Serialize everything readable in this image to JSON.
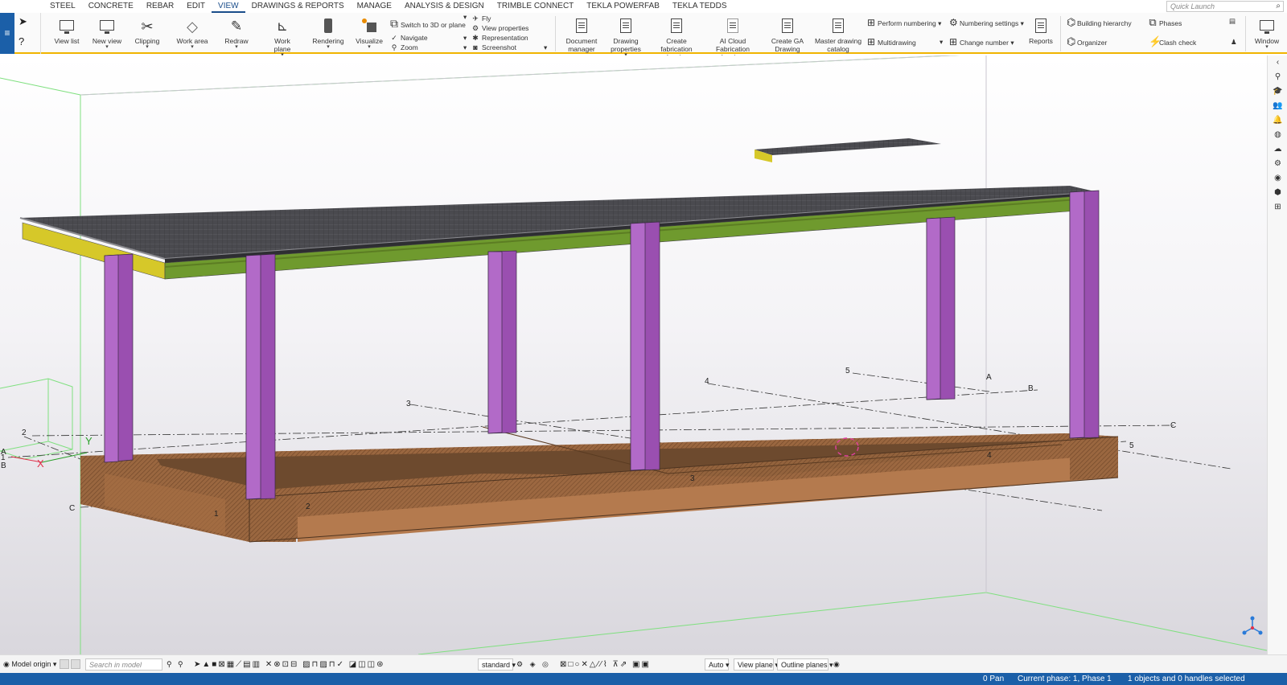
{
  "menu": [
    "STEEL",
    "CONCRETE",
    "REBAR",
    "EDIT",
    "VIEW",
    "DRAWINGS & REPORTS",
    "MANAGE",
    "ANALYSIS & DESIGN",
    "TRIMBLE CONNECT",
    "TEKLA POWERFAB",
    "TEKLA TEDDS"
  ],
  "quick_launch": {
    "placeholder": "Quick Launch"
  },
  "ribbon": {
    "view_list": "View list",
    "new_view": "New view",
    "clipping": "Clipping",
    "work_area": "Work area",
    "redraw": "Redraw",
    "work_plane": "Work plane",
    "rendering": "Rendering",
    "visualize": "Visualize",
    "switch_3d": "Switch to 3D or plane",
    "navigate": "Navigate",
    "zoom": "Zoom",
    "fly": "Fly",
    "view_properties": "View properties",
    "representation": "Representation",
    "screenshot": "Screenshot",
    "document_manager": [
      "Document",
      "manager"
    ],
    "drawing_properties": [
      "Drawing",
      "properties"
    ],
    "create_fabrication": [
      "Create fabrication",
      "drawing"
    ],
    "ai_cloud": [
      "AI Cloud Fabrication",
      "drawings"
    ],
    "create_ga": [
      "Create GA",
      "Drawing"
    ],
    "master_catalog": [
      "Master drawing",
      "catalog"
    ],
    "perform_numbering": "Perform numbering",
    "multidrawing": "Multidrawing",
    "numbering_settings": "Numbering settings",
    "change_number": "Change number",
    "reports": "Reports",
    "building_hierarchy": "Building hierarchy",
    "organizer": "Organizer",
    "phases": "Phases",
    "clash_check": "Clash check",
    "window": "Window"
  },
  "model": {
    "grid_labels_top": [
      "3",
      "4",
      "5",
      "A",
      "B",
      "C"
    ],
    "grid_labels_front": [
      "1",
      "2",
      "3",
      "4",
      "5"
    ],
    "grid_labels_left": [
      "2",
      "A",
      "1",
      "B",
      "C"
    ],
    "axis_x": "X",
    "axis_y": "Y",
    "colors": {
      "roof": "#4d4d52",
      "green_beam": "#6f9a2e",
      "yellow_beam": "#d6c829",
      "column": "#9a4fb0",
      "timber": "#a8714a",
      "timber_dark": "#6a4a30"
    }
  },
  "bottombar": {
    "model_origin": "Model origin",
    "search_placeholder": "Search in model",
    "standard": "standard",
    "auto": "Auto",
    "view_plane": "View plane",
    "outline_planes": "Outline planes"
  },
  "status": {
    "pan": "0 Pan",
    "phase": "Current phase: 1, Phase 1",
    "selection": "1 objects and 0 handles selected"
  }
}
